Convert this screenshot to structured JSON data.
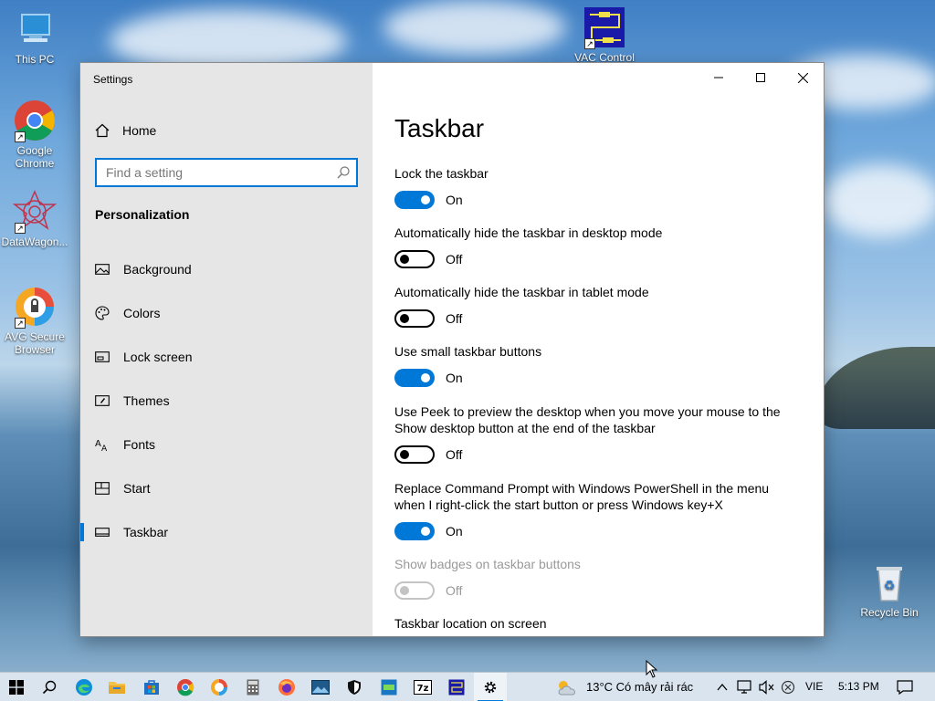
{
  "desktop": {
    "icons": [
      {
        "label": "This PC"
      },
      {
        "label": "Google Chrome"
      },
      {
        "label": "DataWagon..."
      },
      {
        "label": "AVG Secure Browser"
      },
      {
        "label": "VAC Control"
      },
      {
        "label": "Recycle Bin"
      }
    ]
  },
  "window": {
    "title": "Settings",
    "sidebar": {
      "home_label": "Home",
      "search_placeholder": "Find a setting",
      "section_title": "Personalization",
      "items": [
        {
          "label": "Background",
          "icon": "image-icon"
        },
        {
          "label": "Colors",
          "icon": "palette-icon"
        },
        {
          "label": "Lock screen",
          "icon": "lock-screen-icon"
        },
        {
          "label": "Themes",
          "icon": "themes-icon"
        },
        {
          "label": "Fonts",
          "icon": "fonts-icon"
        },
        {
          "label": "Start",
          "icon": "start-icon"
        },
        {
          "label": "Taskbar",
          "icon": "taskbar-icon",
          "active": true
        }
      ]
    },
    "content": {
      "title": "Taskbar",
      "settings": [
        {
          "label": "Lock the taskbar",
          "state": "On"
        },
        {
          "label": "Automatically hide the taskbar in desktop mode",
          "state": "Off"
        },
        {
          "label": "Automatically hide the taskbar in tablet mode",
          "state": "Off"
        },
        {
          "label": "Use small taskbar buttons",
          "state": "On"
        },
        {
          "label": "Use Peek to preview the desktop when you move your mouse to the Show desktop button at the end of the taskbar",
          "state": "Off"
        },
        {
          "label": "Replace Command Prompt with Windows PowerShell in the menu when I right-click the start button or press Windows key+X",
          "state": "On"
        },
        {
          "label": "Show badges on taskbar buttons",
          "state": "Off",
          "disabled": true
        },
        {
          "label": "Taskbar location on screen"
        }
      ]
    }
  },
  "taskbar": {
    "weather": "13°C  Có mây rải rác",
    "language": "VIE",
    "time": "5:13 PM"
  },
  "colors": {
    "accent": "#0078d7",
    "sidebar_bg": "#e6e6e6",
    "taskbar_bg": "#d9e4ee"
  }
}
